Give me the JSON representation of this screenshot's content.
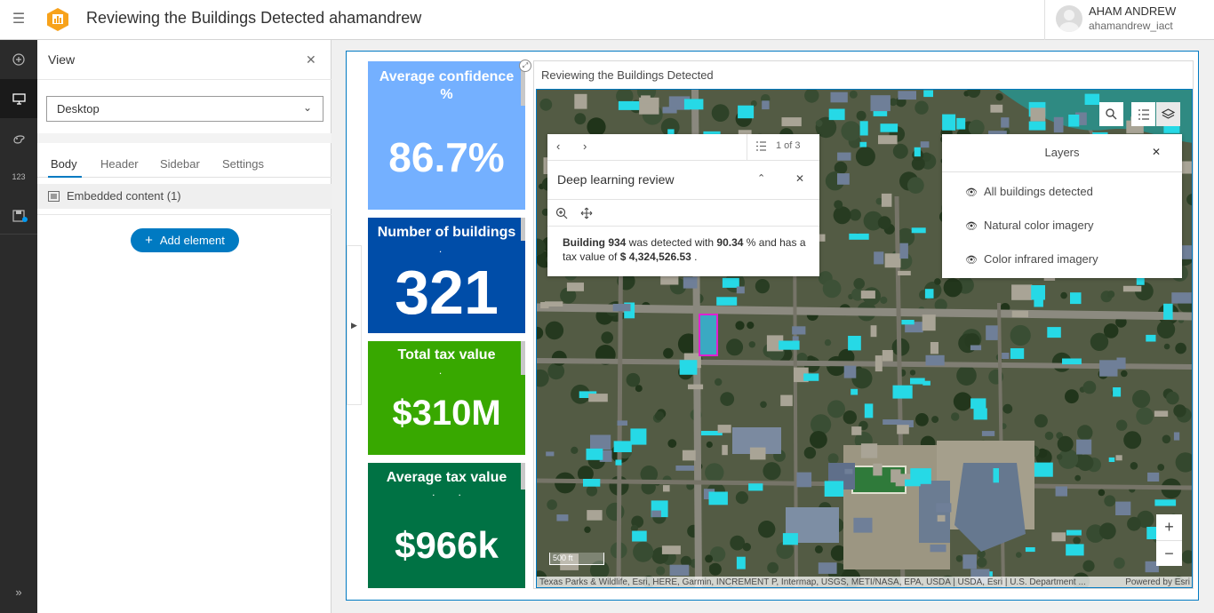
{
  "header": {
    "title": "Reviewing the Buildings Detected ahamandrew",
    "user_name": "AHAM ANDREW",
    "user_id": "ahamandrew_iact",
    "brand_color": "#f7a21b"
  },
  "rail": {
    "items": [
      "add-icon",
      "desktop-icon",
      "theme-icon",
      "data-icon",
      "save-icon"
    ],
    "expand_icon": "double-chevron-right-icon"
  },
  "panel": {
    "title": "View",
    "device": "Desktop",
    "tabs": [
      "Body",
      "Header",
      "Sidebar",
      "Settings"
    ],
    "active_tab": "Body",
    "embedded_label": "Embedded content (1)",
    "add_button": "Add element"
  },
  "cards": [
    {
      "title": "Average confidence %",
      "value": "86.7%",
      "color": "#74b0ff"
    },
    {
      "title": "Number of buildings",
      "value": "321",
      "color": "#004da8"
    },
    {
      "title": "Total tax value",
      "value": "$310M",
      "color": "#38a800"
    },
    {
      "title": "Average tax value",
      "value": "$966k",
      "color": "#007244"
    }
  ],
  "map": {
    "title": "Reviewing the Buildings Detected",
    "popup": {
      "count": "1 of 3",
      "heading": "Deep learning review",
      "body_prefix": "Building 934",
      "body_mid1": " was detected with ",
      "confidence": "90.34",
      "body_mid2": " % and has a tax value of ",
      "tax_value": "$ 4,324,526.53",
      "body_suffix": " ."
    },
    "layers": {
      "title": "Layers",
      "items": [
        "All buildings detected",
        "Natural color imagery",
        "Color infrared imagery"
      ]
    },
    "scale": "500 ft",
    "attribution": "Texas Parks & Wildlife, Esri, HERE, Garmin, INCREMENT P, Intermap, USGS, METI/NASA, EPA, USDA | USDA, Esri | U.S. Department ...",
    "powered_by": "Powered by Esri",
    "detection_color": "#26d9e6",
    "selected_color": "#e020d0"
  }
}
